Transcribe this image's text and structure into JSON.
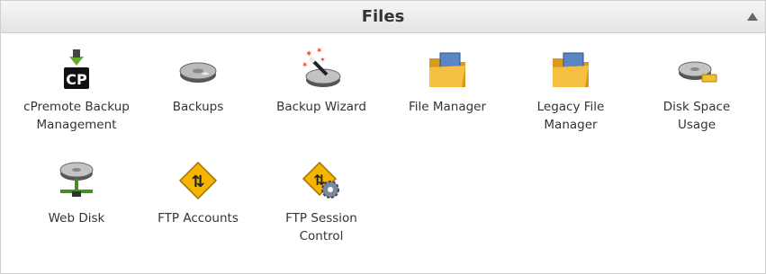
{
  "panel": {
    "title": "Files"
  },
  "items": [
    {
      "label": "cPremote Backup Management",
      "icon": "cp-backup-icon"
    },
    {
      "label": "Backups",
      "icon": "disk-icon"
    },
    {
      "label": "Backup Wizard",
      "icon": "wizard-disk-icon"
    },
    {
      "label": "File Manager",
      "icon": "folder-icon"
    },
    {
      "label": "Legacy File Manager",
      "icon": "folder-icon"
    },
    {
      "label": "Disk Space Usage",
      "icon": "disk-usage-icon"
    },
    {
      "label": "Web Disk",
      "icon": "network-disk-icon"
    },
    {
      "label": "FTP Accounts",
      "icon": "ftp-sign-icon"
    },
    {
      "label": "FTP Session Control",
      "icon": "ftp-gear-icon"
    }
  ],
  "colors": {
    "header_bg": "#e9e9e9",
    "text": "#333333",
    "folder": "#f0b030",
    "ftp_sign": "#f4b400",
    "cp_green": "#6aaa2a"
  }
}
